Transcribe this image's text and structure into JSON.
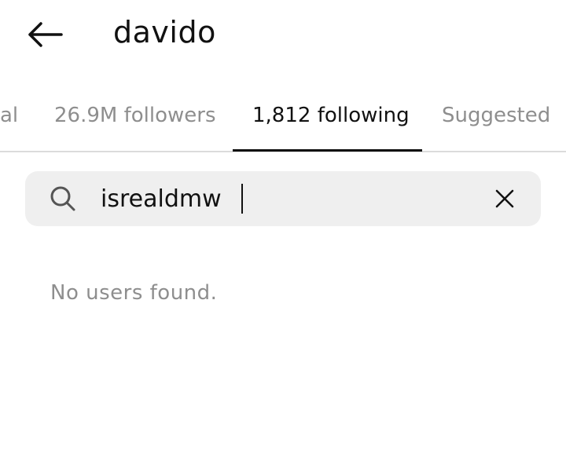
{
  "header": {
    "title": "davido",
    "back_icon": "arrow-left-icon"
  },
  "tabs": {
    "items": [
      {
        "label": "al",
        "active": false
      },
      {
        "label": "26.9M followers",
        "active": false
      },
      {
        "label": "1,812 following",
        "active": true
      },
      {
        "label": "Suggested",
        "active": false
      }
    ]
  },
  "search": {
    "value": "isrealdmw",
    "search_icon": "search-icon",
    "clear_icon": "close-icon"
  },
  "results": {
    "empty_message": "No users found."
  },
  "colors": {
    "text_primary": "#111111",
    "text_secondary": "#8e8e8e",
    "search_bg": "#efefef",
    "divider": "#dbdbdb"
  }
}
